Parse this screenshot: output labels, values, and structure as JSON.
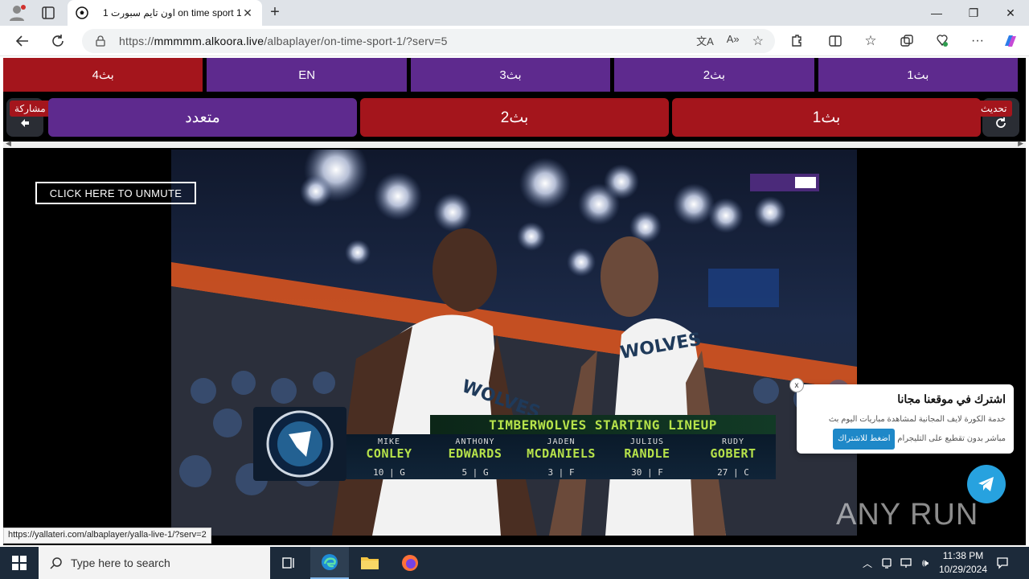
{
  "browser": {
    "tab_title": "اون تايم سبورت 1 on time sport 1",
    "url_prefix": "https://",
    "url_host": "mmmmm.alkoora.live",
    "url_path": "/albaplayer/on-time-sport-1/?serv=5"
  },
  "top_row": [
    "بث4",
    "EN",
    "بث3",
    "بث2",
    "بث1"
  ],
  "second_row": {
    "share_label": "مشاركة",
    "refresh_label": "تحديث",
    "buttons": [
      "متعدد",
      "بث2",
      "بث1"
    ]
  },
  "player": {
    "unmute_label": "CLICK HERE TO UNMUTE",
    "lineup_title": "TIMBERWOLVES STARTING LINEUP",
    "players": [
      {
        "first": "MIKE",
        "last": "CONLEY",
        "number": "10",
        "pos": "G"
      },
      {
        "first": "ANTHONY",
        "last": "EDWARDS",
        "number": "5",
        "pos": "G"
      },
      {
        "first": "JADEN",
        "last": "MCDANIELS",
        "number": "3",
        "pos": "F"
      },
      {
        "first": "JULIUS",
        "last": "RANDLE",
        "number": "30",
        "pos": "F"
      },
      {
        "first": "RUDY",
        "last": "GOBERT",
        "number": "27",
        "pos": "C"
      }
    ]
  },
  "popup": {
    "title": "اشترك في موقعنا مجانا",
    "description_line1": "خدمة الكورة لايف المجانية لمشاهدة مباريات اليوم بث",
    "description_line2": "مباشر بدون تقطيع على التليجرام",
    "button": "اضغط للاشتراك",
    "close": "x"
  },
  "watermark": "ANY RUN",
  "status_url": "https://yallateri.com/albaplayer/yalla-live-1/?serv=2",
  "taskbar": {
    "search_placeholder": "Type here to search",
    "time": "11:38 PM",
    "date": "10/29/2024"
  },
  "colors": {
    "red": "#a4151c",
    "purple": "#5e2a8e",
    "telegram": "#27a2df"
  }
}
